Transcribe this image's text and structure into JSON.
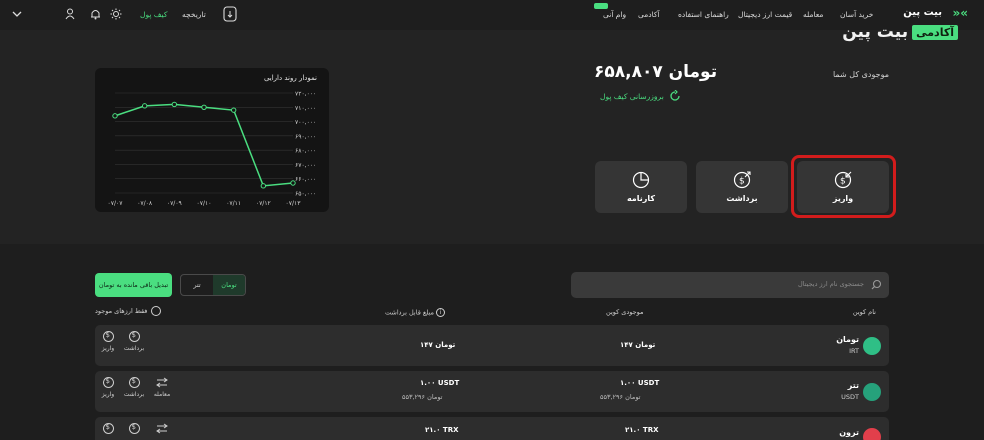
{
  "nav": {
    "items": [
      {
        "label": "خرید آسان"
      },
      {
        "label": "معامله"
      },
      {
        "label": "قیمت ارز دیجیتال"
      },
      {
        "label": "راهنمای استفاده"
      },
      {
        "label": "آکادمی"
      },
      {
        "label": "وام آنی"
      }
    ],
    "brand": "بیت پین",
    "academy_tag": "آکادمی",
    "academy_name": "بیت پین",
    "wallet_tab": "کیف پول",
    "history_tab": "تاریخچه"
  },
  "balance": {
    "label": "موجودی کل شما",
    "value": "۶۵۸,۸۰۷ تومان",
    "refresh_label": "بروزرسانی کیف پول"
  },
  "actions": {
    "deposit": "واریز",
    "withdraw": "برداشت",
    "history": "کارنامه"
  },
  "chart_data": {
    "type": "line",
    "title": "نمودار روند دارایی",
    "categories": [
      "۰۷/۰۷",
      "۰۷/۰۸",
      "۰۷/۰۹",
      "۰۷/۱۰",
      "۰۷/۱۱",
      "۰۷/۱۲",
      "۰۷/۱۳"
    ],
    "ytick_labels": [
      "۷۲۰,۰۰۰",
      "۷۱۰,۰۰۰",
      "۷۰۰,۰۰۰",
      "۶۹۰,۰۰۰",
      "۶۸۰,۰۰۰",
      "۶۷۰,۰۰۰",
      "۶۶۰,۰۰۰",
      "۶۵۰,۰۰۰"
    ],
    "yticks": [
      720000,
      710000,
      700000,
      690000,
      680000,
      670000,
      660000,
      650000
    ],
    "ylim": [
      650000,
      720000
    ],
    "series": [
      {
        "values": [
          704000,
          711000,
          712000,
          710000,
          708000,
          655000,
          657000
        ]
      }
    ],
    "color": "#4ade80",
    "grid": true
  },
  "filters": {
    "search_placeholder": "جستجوی نام ارز دیجیتال",
    "toggle_toman": "تومان",
    "toggle_tether": "تتر",
    "convert_button": "تبدیل باقی مانده به تومان",
    "only_available": "فقط ارزهای موجود"
  },
  "table": {
    "headers": {
      "coin": "نام کوین",
      "balance": "موجودی کوین",
      "withdrawable": "مبلغ قابل برداشت"
    },
    "rows": [
      {
        "name": "تومان",
        "symbol": "IRT",
        "balance": "۱۴۷ تومان",
        "balance_sub": "",
        "withdrawable": "۱۴۷ تومان",
        "withdrawable_sub": "",
        "color": "#2fbf86"
      },
      {
        "name": "تتر",
        "symbol": "USDT",
        "balance": "۱.۰۰ USDT",
        "balance_sub": "۵۵۳,۲۹۶ تومان",
        "withdrawable": "۱.۰۰ USDT",
        "withdrawable_sub": "۵۵۳,۲۹۶ تومان",
        "color": "#26a17b"
      },
      {
        "name": "ترون",
        "symbol": "",
        "balance": "۲۱.۰ TRX",
        "balance_sub": "",
        "withdrawable": "۲۱.۰ TRX",
        "withdrawable_sub": "",
        "color": "#e23f4b"
      }
    ],
    "row_actions": {
      "deposit": "واریز",
      "withdraw": "برداشت",
      "trade": "معامله"
    }
  }
}
